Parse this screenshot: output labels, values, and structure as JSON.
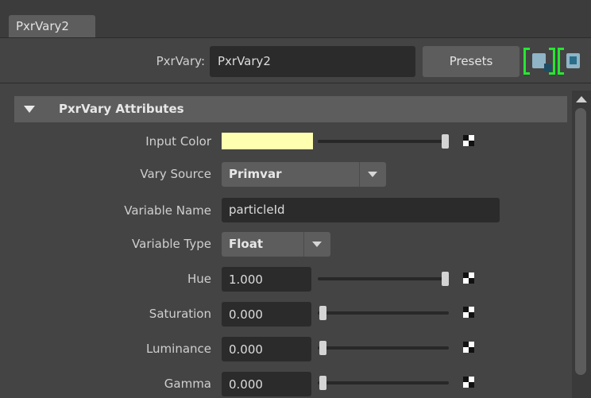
{
  "tab": {
    "label": "PxrVary2"
  },
  "node": {
    "type_label": "PxrVary:",
    "name_value": "PxrVary2",
    "presets_label": "Presets"
  },
  "section": {
    "title": "PxrVary Attributes"
  },
  "attributes": {
    "input_color": {
      "label": "Input Color",
      "color": "#ffffb0",
      "slider_fraction": 1.0
    },
    "vary_source": {
      "label": "Vary Source",
      "value": "Primvar"
    },
    "variable_name": {
      "label": "Variable Name",
      "value": "particleId"
    },
    "variable_type": {
      "label": "Variable Type",
      "value": "Float"
    },
    "hue": {
      "label": "Hue",
      "value": "1.000",
      "slider_fraction": 1.0
    },
    "saturation": {
      "label": "Saturation",
      "value": "0.000",
      "slider_fraction": 0.0
    },
    "luminance": {
      "label": "Luminance",
      "value": "0.000",
      "slider_fraction": 0.0
    },
    "gamma": {
      "label": "Gamma",
      "value": "0.000",
      "slider_fraction": 0.0
    }
  },
  "icons": {
    "select_input": "input-connection-icon",
    "select_output": "output-connection-icon",
    "map_button": "checker-map-icon"
  },
  "colors": {
    "accent_bracket": "#27e632",
    "panel_bg": "#444444",
    "field_bg": "#2b2b2b"
  }
}
